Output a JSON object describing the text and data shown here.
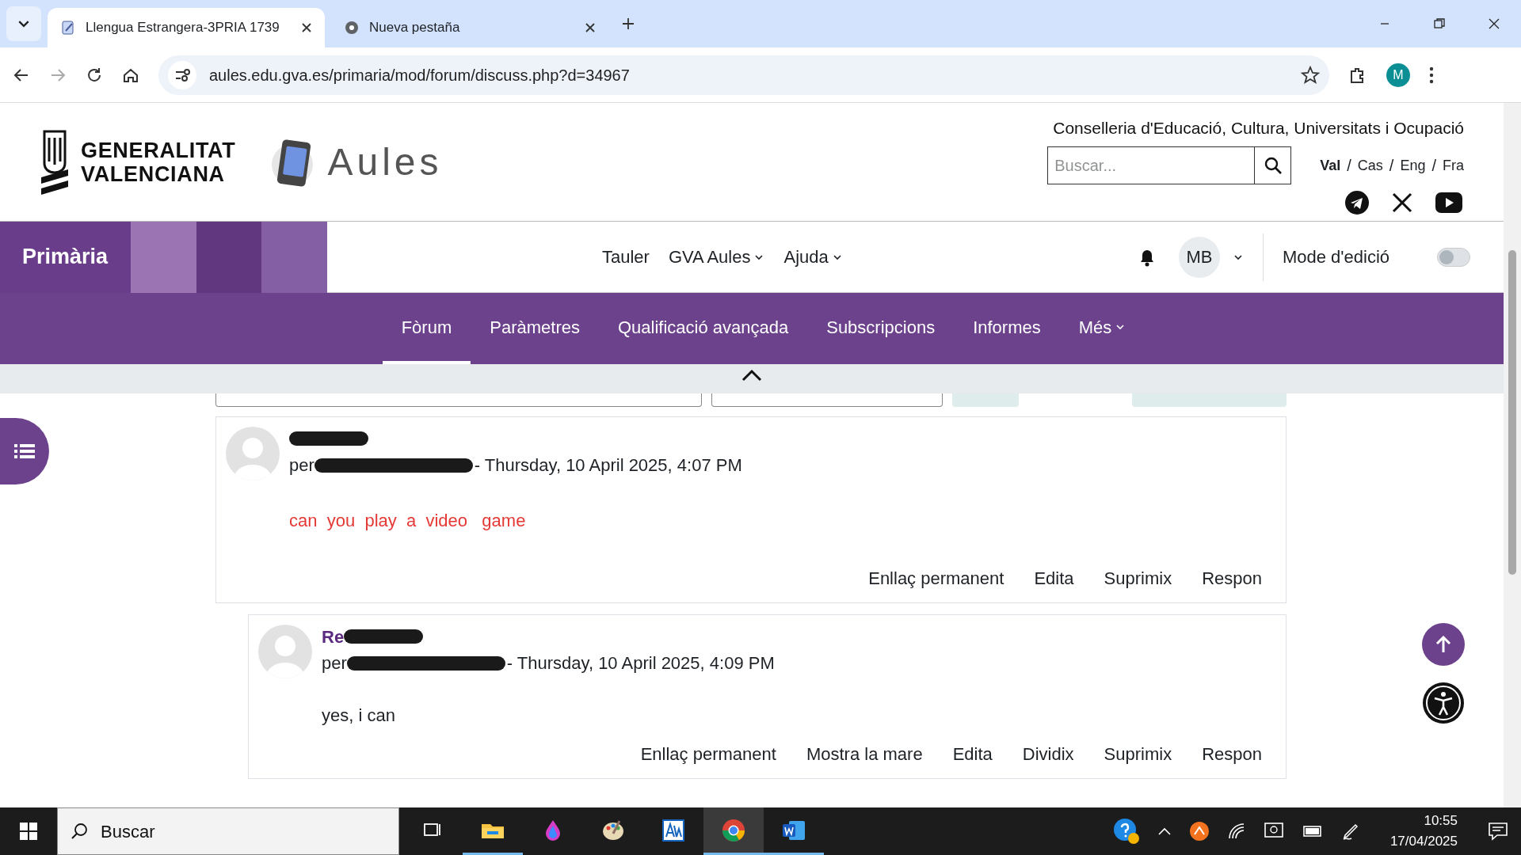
{
  "browser": {
    "tabs": [
      {
        "title": "Llengua Estrangera-3PRIA 1739",
        "selected": true
      },
      {
        "title": "Nueva pestaña",
        "selected": false
      }
    ],
    "url": "aules.edu.gva.es/primaria/mod/forum/discuss.php?d=34967",
    "profile": "M"
  },
  "header": {
    "logo_lines": [
      "GENERALITAT",
      "VALENCIANA"
    ],
    "app_name": "Aules",
    "ministry": "Conselleria d'Educació, Cultura, Universitats i Ocupació",
    "search": {
      "placeholder": "Buscar..."
    },
    "language_separator": "/",
    "languages": [
      {
        "label": "Val",
        "selected": true
      },
      {
        "label": "Cas",
        "selected": false
      },
      {
        "label": "Eng",
        "selected": false
      },
      {
        "label": "Fra",
        "selected": false
      }
    ]
  },
  "navbar": {
    "site": "Primària",
    "menu": [
      {
        "label": "Tauler",
        "dropdown": false
      },
      {
        "label": "GVA Aules",
        "dropdown": true
      },
      {
        "label": "Ajuda",
        "dropdown": true
      }
    ],
    "user": "MB",
    "edit_mode": {
      "label": "Mode d'edició",
      "on": false
    }
  },
  "secondary_nav": [
    {
      "label": "Fòrum",
      "selected": true,
      "dropdown": false
    },
    {
      "label": "Paràmetres",
      "selected": false,
      "dropdown": false
    },
    {
      "label": "Qualificació avançada",
      "selected": false,
      "dropdown": false
    },
    {
      "label": "Subscripcions",
      "selected": false,
      "dropdown": false
    },
    {
      "label": "Informes",
      "selected": false,
      "dropdown": false
    },
    {
      "label": "Més",
      "selected": false,
      "dropdown": true
    }
  ],
  "toolbar": [
    {
      "kind": "select_wide"
    },
    {
      "kind": "select"
    },
    {
      "kind": "button"
    },
    {
      "kind": "spacer"
    },
    {
      "kind": "button_wide"
    }
  ],
  "posts": [
    {
      "author_prefix": "per",
      "date": "- Thursday, 10 April 2025, 4:07 PM",
      "message": "can  you  play  a  video   game",
      "color": "#e53935",
      "actions": [
        "Enllaç permanent",
        "Edita",
        "Suprimix",
        "Respon"
      ],
      "replies": [
        {
          "subject": "Re",
          "author_prefix": "per",
          "date": "- Thursday, 10 April 2025, 4:09 PM",
          "message": "yes, i can",
          "color": "#1d2125",
          "actions": [
            "Enllaç permanent",
            "Mostra la mare",
            "Edita",
            "Dividix",
            "Suprimix",
            "Respon"
          ]
        }
      ]
    }
  ],
  "taskbar": {
    "search": "Buscar",
    "apps": [
      {
        "kind": "taskview",
        "selected": false
      },
      {
        "kind": "files",
        "selected": true
      },
      {
        "kind": "drop",
        "selected": false
      },
      {
        "kind": "palette",
        "selected": false
      },
      {
        "kind": "aw",
        "selected": false
      },
      {
        "kind": "chrome",
        "selected": true
      },
      {
        "kind": "word",
        "selected": true
      }
    ],
    "time": "10:55",
    "date": "17/04/2025"
  }
}
